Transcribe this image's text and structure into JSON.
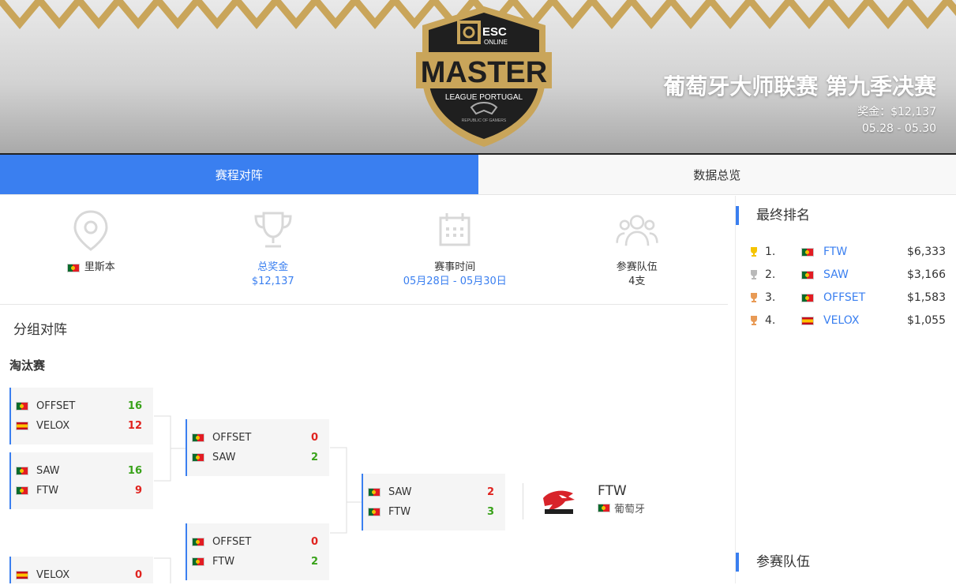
{
  "banner": {
    "title": "葡萄牙大师联赛 第九季决赛",
    "prize": "奖金：$12,137",
    "dates": "05.28 - 05.30",
    "logo": {
      "top_text": "ESC",
      "sub_text": "ONLINE",
      "main_text": "MASTER",
      "league_text": "LEAGUE PORTUGAL",
      "sponsor_text": "REPUBLIC OF GAMERS"
    }
  },
  "tabs": [
    {
      "label": "赛程对阵",
      "active": true
    },
    {
      "label": "数据总览",
      "active": false
    }
  ],
  "info": {
    "location": {
      "icon": "location-pin-icon",
      "label": "里斯本",
      "flag": "pt"
    },
    "prize": {
      "icon": "trophy-icon",
      "label": "总奖金",
      "value": "$12,137"
    },
    "time": {
      "icon": "calendar-icon",
      "label": "赛事时间",
      "value": "05月28日 - 05月30日"
    },
    "teams": {
      "icon": "team-icon",
      "label": "参赛队伍",
      "value": "4支"
    }
  },
  "bracket": {
    "section_title": "分组对阵",
    "stage_title": "淘汰赛",
    "matches": [
      {
        "teams": [
          {
            "name": "OFFSET",
            "flag": "pt",
            "score": "16",
            "result": "win"
          },
          {
            "name": "VELOX",
            "flag": "es",
            "score": "12",
            "result": "lose"
          }
        ]
      },
      {
        "teams": [
          {
            "name": "SAW",
            "flag": "pt",
            "score": "16",
            "result": "win"
          },
          {
            "name": "FTW",
            "flag": "pt",
            "score": "9",
            "result": "lose"
          }
        ]
      },
      {
        "teams": [
          {
            "name": "VELOX",
            "flag": "es",
            "score": "0",
            "result": "lose"
          }
        ]
      },
      {
        "teams": [
          {
            "name": "OFFSET",
            "flag": "pt",
            "score": "0",
            "result": "lose"
          },
          {
            "name": "SAW",
            "flag": "pt",
            "score": "2",
            "result": "win"
          }
        ]
      },
      {
        "teams": [
          {
            "name": "OFFSET",
            "flag": "pt",
            "score": "0",
            "result": "lose"
          },
          {
            "name": "FTW",
            "flag": "pt",
            "score": "2",
            "result": "win"
          }
        ]
      },
      {
        "teams": [
          {
            "name": "SAW",
            "flag": "pt",
            "score": "2",
            "result": "lose"
          },
          {
            "name": "FTW",
            "flag": "pt",
            "score": "3",
            "result": "win"
          }
        ]
      }
    ],
    "winner": {
      "name": "FTW",
      "country": "葡萄牙",
      "flag": "pt"
    }
  },
  "ranking": {
    "title": "最终排名",
    "rows": [
      {
        "rank": "1.",
        "team": "FTW",
        "flag": "pt",
        "prize": "$6,333",
        "trophy_color": "#f5c400"
      },
      {
        "rank": "2.",
        "team": "SAW",
        "flag": "pt",
        "prize": "$3,166",
        "trophy_color": "#b9b9b9"
      },
      {
        "rank": "3.",
        "team": "OFFSET",
        "flag": "pt",
        "prize": "$1,583",
        "trophy_color": "#e89a55"
      },
      {
        "rank": "4.",
        "team": "VELOX",
        "flag": "es",
        "prize": "$1,055",
        "trophy_color": "#e89a55"
      }
    ],
    "teams_title": "参赛队伍"
  },
  "colors": {
    "accent": "#3a7ff0",
    "win": "#39a21a",
    "lose": "#e0231f",
    "gold": "#c9a55a"
  }
}
